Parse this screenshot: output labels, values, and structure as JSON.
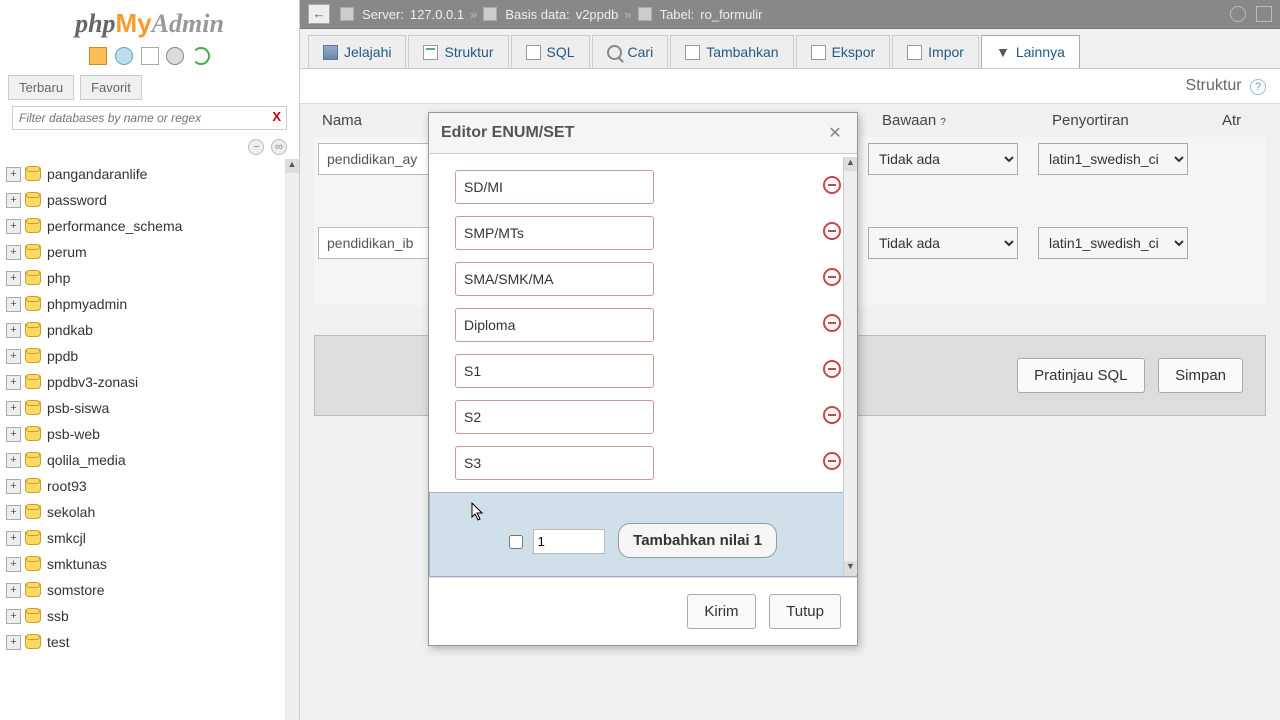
{
  "logo": {
    "php": "php",
    "my": "My",
    "admin": "Admin"
  },
  "sidebar": {
    "tabs": [
      "Terbaru",
      "Favorit"
    ],
    "filter_placeholder": "Filter databases by name or regex",
    "items": [
      "pangandaranlife",
      "password",
      "performance_schema",
      "perum",
      "php",
      "phpmyadmin",
      "pndkab",
      "ppdb",
      "ppdbv3-zonasi",
      "psb-siswa",
      "psb-web",
      "qolila_media",
      "root93",
      "sekolah",
      "smkcjl",
      "smktunas",
      "somstore",
      "ssb",
      "test"
    ]
  },
  "breadcrumb": {
    "server_label": "Server:",
    "server": "127.0.0.1",
    "db_label": "Basis data:",
    "db": "v2ppdb",
    "table_label": "Tabel:",
    "table": "ro_formulir"
  },
  "maintabs": [
    "Jelajahi",
    "Struktur",
    "SQL",
    "Cari",
    "Tambahkan",
    "Ekspor",
    "Impor",
    "Lainnya"
  ],
  "subheader": {
    "text": "Struktur"
  },
  "columns": {
    "name": "Nama",
    "default": "Bawaan",
    "collation": "Penyortiran",
    "attr": "Atr"
  },
  "rows": [
    {
      "name": "pendidikan_ay",
      "default": "Tidak ada",
      "collation": "latin1_swedish_ci"
    },
    {
      "name": "pendidikan_ib",
      "default": "Tidak ada",
      "collation": "latin1_swedish_ci"
    }
  ],
  "actions": {
    "preview": "Pratinjau SQL",
    "save": "Simpan"
  },
  "modal": {
    "title": "Editor ENUM/SET",
    "values": [
      "SD/MI",
      "SMP/MTs",
      "SMA/SMK/MA",
      "Diploma",
      "S1",
      "S2",
      "S3"
    ],
    "add_value": "1",
    "add_label": "Tambahkan nilai 1",
    "submit": "Kirim",
    "close": "Tutup"
  }
}
